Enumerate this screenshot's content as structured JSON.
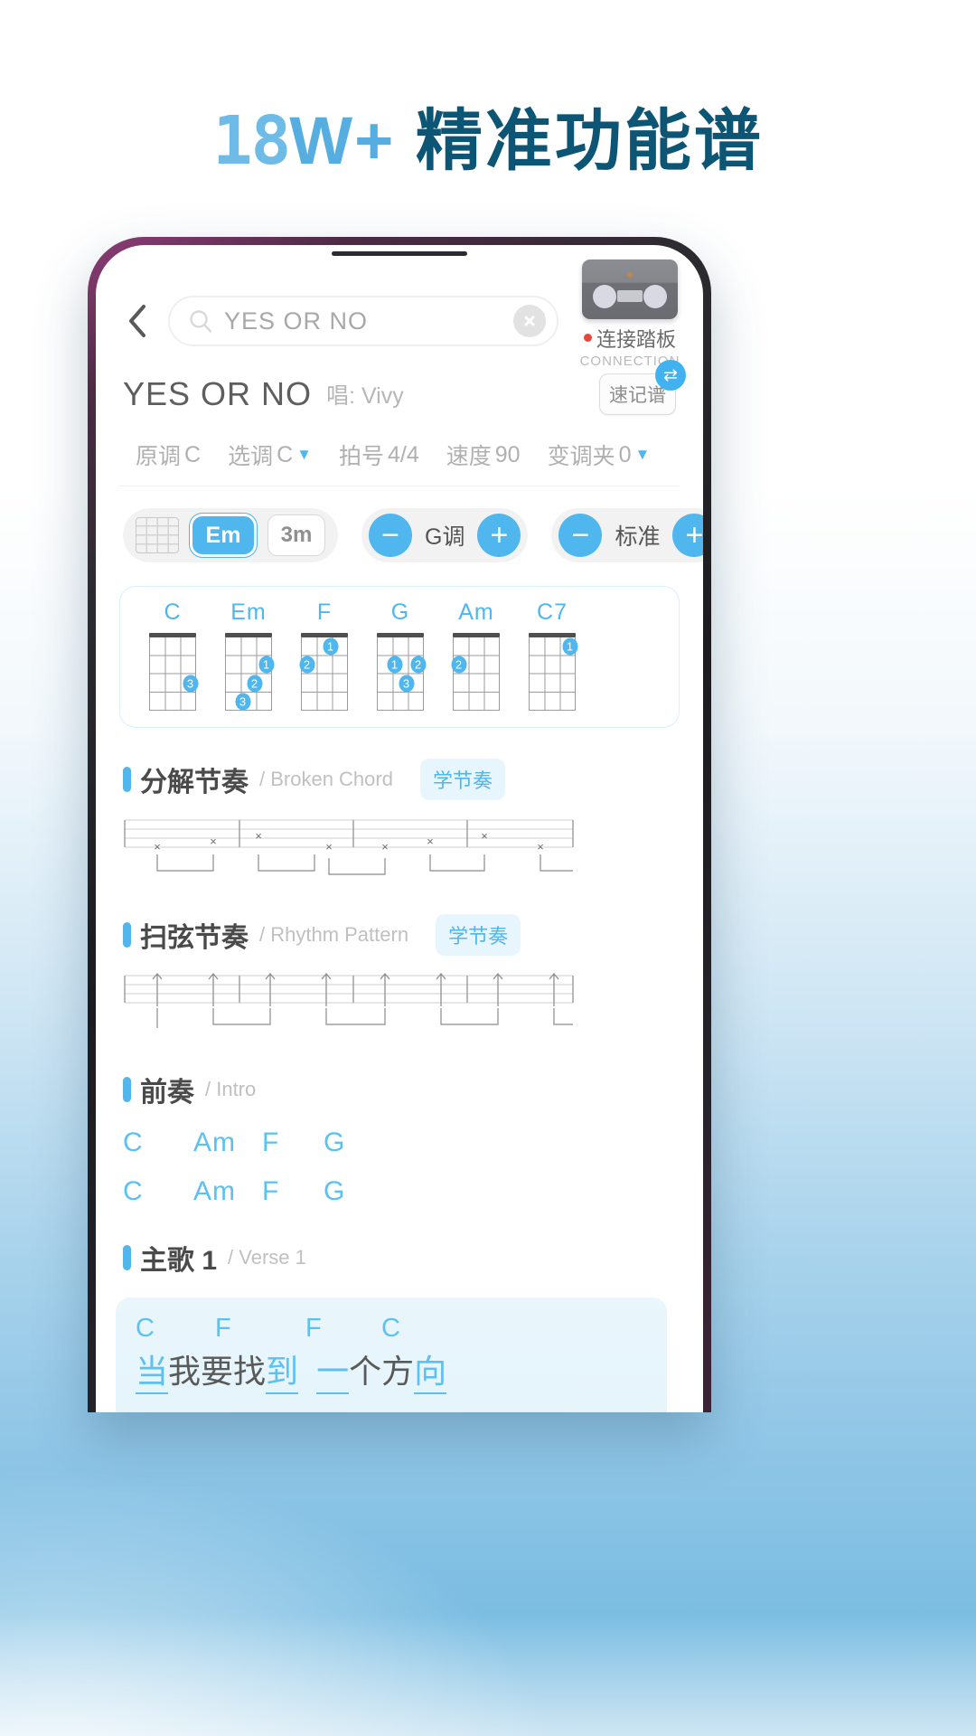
{
  "headline": {
    "number": "18",
    "plus": "W+",
    "text": "精准功能谱"
  },
  "search": {
    "back_icon": "chevron-left-icon",
    "search_icon": "search-icon",
    "value": "YES OR NO",
    "clear_icon": "close-circle-icon"
  },
  "pedal": {
    "label": "连接踏板",
    "sublabel": "CONNECTION",
    "status_color": "#e8463c"
  },
  "song": {
    "title": "YES OR NO",
    "artist_prefix": "唱:",
    "artist": "Vivy",
    "shorthand_label": "速记谱",
    "shorthand_badge_icon": "swap-icon"
  },
  "meta": [
    {
      "label": "原调",
      "value": "C",
      "caret": false
    },
    {
      "label": "选调",
      "value": "C",
      "caret": true
    },
    {
      "label": "拍号",
      "value": "4/4",
      "caret": false
    },
    {
      "label": "速度",
      "value": "90",
      "caret": false
    },
    {
      "label": "变调夹",
      "value": "0",
      "caret": true
    }
  ],
  "controls": {
    "grid_icon": "chord-grid-icon",
    "chip_active": "Em",
    "chip_plain": "3m",
    "key_stepper": {
      "minus": "−",
      "label": "G调",
      "plus": "+"
    },
    "tuning_stepper": {
      "minus": "−",
      "label": "标准",
      "plus": "+"
    }
  },
  "chords": [
    {
      "name": "C",
      "dots": [
        {
          "string": 3,
          "fret": 3,
          "finger": "3"
        }
      ]
    },
    {
      "name": "Em",
      "dots": [
        {
          "string": 3,
          "fret": 2,
          "finger": "1"
        },
        {
          "string": 2,
          "fret": 3,
          "finger": "2"
        },
        {
          "string": 1,
          "fret": 4,
          "finger": "3"
        }
      ]
    },
    {
      "name": "F",
      "dots": [
        {
          "string": 2,
          "fret": 1,
          "finger": "1"
        },
        {
          "string": 0,
          "fret": 2,
          "finger": "2"
        }
      ]
    },
    {
      "name": "G",
      "dots": [
        {
          "string": 1,
          "fret": 2,
          "finger": "1"
        },
        {
          "string": 3,
          "fret": 2,
          "finger": "2"
        },
        {
          "string": 2,
          "fret": 3,
          "finger": "3"
        }
      ]
    },
    {
      "name": "Am",
      "dots": [
        {
          "string": 0,
          "fret": 2,
          "finger": "2"
        }
      ]
    },
    {
      "name": "C7",
      "dots": [
        {
          "string": 3,
          "fret": 1,
          "finger": "1"
        }
      ]
    }
  ],
  "sections": {
    "broken": {
      "zh": "分解节奏",
      "en": "/ Broken Chord",
      "learn": "学节奏"
    },
    "strum": {
      "zh": "扫弦节奏",
      "en": "/ Rhythm Pattern",
      "learn": "学节奏"
    },
    "intro": {
      "zh": "前奏",
      "en": "/ Intro"
    },
    "verse": {
      "zh": "主歌 1",
      "en": "/ Verse 1"
    }
  },
  "intro_lines": [
    [
      "C",
      "Am",
      "F",
      "G"
    ],
    [
      "C",
      "Am",
      "F",
      "G"
    ]
  ],
  "verse": {
    "chords": [
      "C",
      "F",
      "F",
      "C"
    ],
    "syllables": [
      {
        "text": "当",
        "highlight": true
      },
      {
        "text": "我要找",
        "highlight": false
      },
      {
        "text": "到",
        "highlight": true
      },
      {
        "text": "一",
        "highlight": true
      },
      {
        "text": "个方",
        "highlight": false
      },
      {
        "text": "向",
        "highlight": true
      }
    ]
  },
  "colors": {
    "accent": "#4fb6ee",
    "accent_light": "#5cc0f0",
    "headline_dark": "#0d5574",
    "headline_light": "#6dbbe6"
  }
}
